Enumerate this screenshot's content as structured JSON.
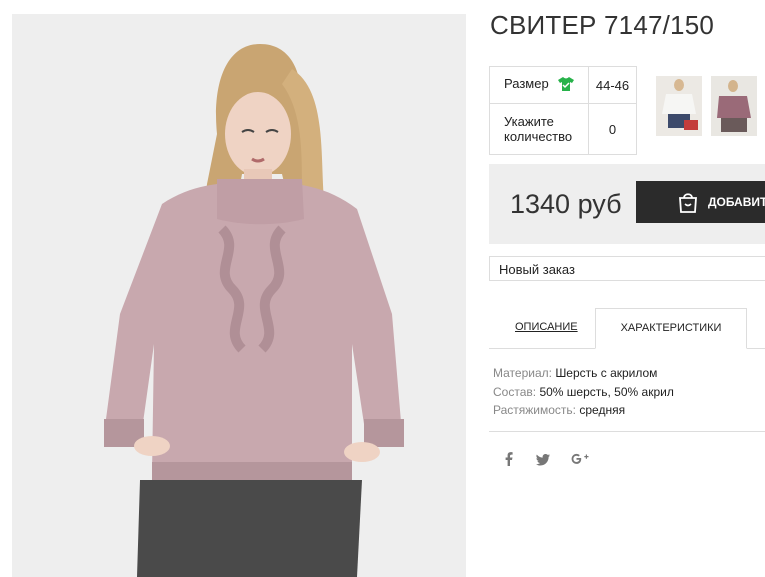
{
  "product": {
    "title": "СВИТЕР 7147/150",
    "options": [
      {
        "label": "Размер",
        "value": "44-46"
      },
      {
        "label": "Укажите количество",
        "value": "0"
      }
    ],
    "price": "1340 руб",
    "add_button_label": "ДОБАВИТЬ",
    "order_select": "Новый заказ",
    "tabs": [
      "ОПИСАНИЕ",
      "ХАРАКТЕРИСТИКИ"
    ],
    "characteristics": [
      {
        "key": "Материал:",
        "value": "Шерсть с акрилом"
      },
      {
        "key": "Состав:",
        "value": "50% шерсть, 50% акрил"
      },
      {
        "key": "Растяжимость:",
        "value": "средняя"
      }
    ],
    "social": [
      "f",
      "t",
      "g+"
    ]
  },
  "colors": {
    "sweater": "#c8a8ae",
    "tshirt": "#27b24a",
    "button": "#2b2b2b",
    "panel": "#eeeeee"
  },
  "icons": [
    "tshirt-icon",
    "shopping-bag-icon",
    "facebook-icon",
    "twitter-icon",
    "google-plus-icon"
  ]
}
